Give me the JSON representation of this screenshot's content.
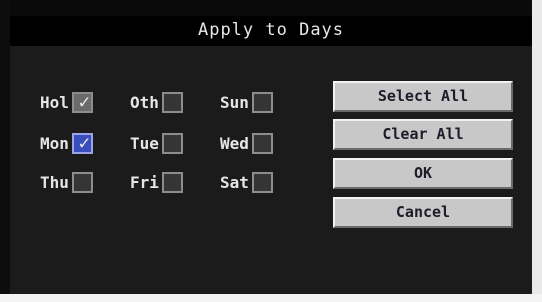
{
  "dialog": {
    "title": "Apply to Days"
  },
  "days": [
    {
      "label": "Hol",
      "checked": true
    },
    {
      "label": "Oth",
      "checked": false
    },
    {
      "label": "Sun",
      "checked": false
    },
    {
      "label": "Mon",
      "checked": true,
      "highlighted": true
    },
    {
      "label": "Tue",
      "checked": false
    },
    {
      "label": "Wed",
      "checked": false
    },
    {
      "label": "Thu",
      "checked": false
    },
    {
      "label": "Fri",
      "checked": false
    },
    {
      "label": "Sat",
      "checked": false
    }
  ],
  "buttons": {
    "select_all": "Select All",
    "clear_all": "Clear All",
    "ok": "OK",
    "cancel": "Cancel"
  },
  "icons": {
    "check": "checkmark-icon"
  },
  "colors": {
    "highlight": "#3a4dbd",
    "button": "#c8c8c8"
  }
}
